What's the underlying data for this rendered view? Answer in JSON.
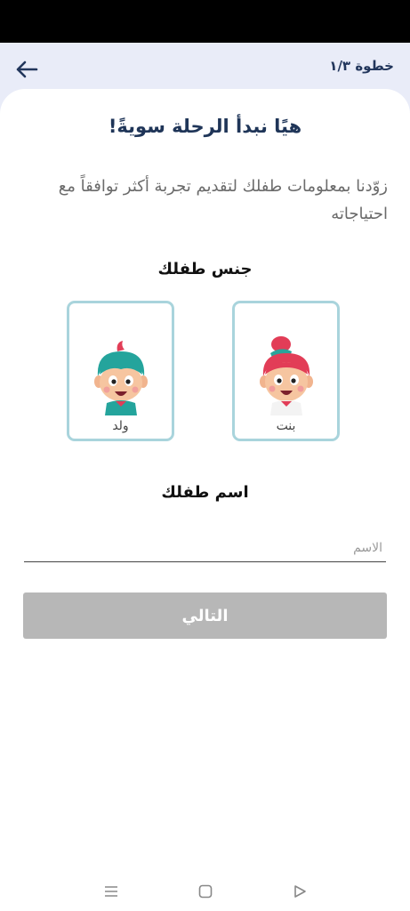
{
  "header": {
    "step_label": "خطوة ١/٣",
    "back_icon": "arrow-left-icon"
  },
  "main": {
    "title": "هيًا نبدأ الرحلة سويةً!",
    "subtitle": "زوّدنا بمعلومات طفلك لتقديم تجربة أكثر توافقاً مع احتياجاته",
    "gender_section_label": "جنس طفلك",
    "gender_options": [
      {
        "label": "بنت",
        "icon": "girl-avatar-icon",
        "hair_color": "#e23d57"
      },
      {
        "label": "ولد",
        "icon": "boy-avatar-icon",
        "hair_color": "#24a49c"
      }
    ],
    "name_section_label": "اسم طفلك",
    "name_input": {
      "placeholder": "الاسم",
      "value": ""
    },
    "next_button_label": "التالي"
  },
  "colors": {
    "header_background": "#e9ecf8",
    "title_text": "#1f3558",
    "card_border": "#a9d4dc",
    "button_disabled": "#b7b7b7"
  },
  "nav_bar": {
    "icons": [
      "menu-icon",
      "home-icon",
      "back-triangle-icon"
    ]
  }
}
